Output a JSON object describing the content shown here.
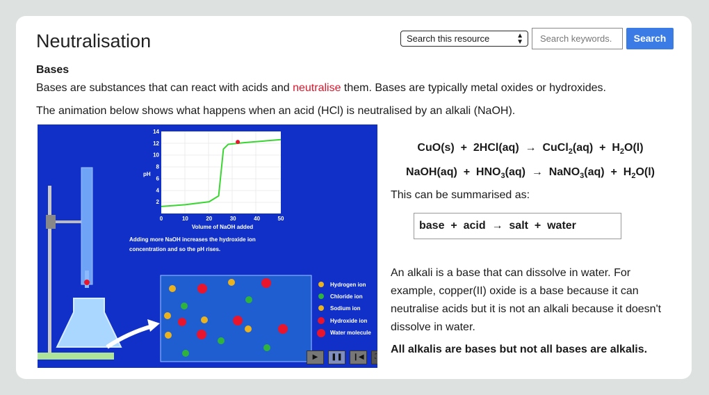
{
  "title": "Neutralisation",
  "search": {
    "scope": "Search this resource",
    "placeholder": "Search keywords.",
    "button": "Search"
  },
  "heading": "Bases",
  "intro": {
    "before": "Bases are substances that can react with acids and ",
    "link": "neutralise",
    "after": " them. Bases are typically metal oxides or hydroxides."
  },
  "animation_intro": "The animation below shows what happens when an acid (HCl) is neutralised by an alkali (NaOH).",
  "animation": {
    "y_label": "pH",
    "x_label": "Volume of NaOH added",
    "caption_1": "Adding more NaOH increases the hydroxide ion",
    "caption_2": "concentration and so the pH rises.",
    "y_ticks": [
      "14",
      "12",
      "10",
      "8",
      "6",
      "4",
      "2"
    ],
    "x_ticks": [
      "0",
      "10",
      "20",
      "30",
      "40",
      "50"
    ],
    "legend": [
      "Hydrogen ion",
      "Chloride ion",
      "Sodium ion",
      "Hydroxide ion",
      "Water molecule"
    ],
    "controls": [
      "play",
      "pause",
      "rewind",
      "fullscreen"
    ]
  },
  "equations": {
    "eq1": {
      "a": "CuO(s)",
      "b": "2HCl(aq)",
      "c_pre": "CuCl",
      "c_sub": "2",
      "c_post": "(aq)",
      "d_pre": "H",
      "d_sub": "2",
      "d_post": "O(l)"
    },
    "eq2": {
      "a": "NaOH(aq)",
      "b_pre": "HNO",
      "b_sub": "3",
      "b_post": "(aq)",
      "c_pre": "NaNO",
      "c_sub": "3",
      "c_post": "(aq)",
      "d_pre": "H",
      "d_sub": "2",
      "d_post": "O(l)"
    },
    "plus": "+",
    "arrow": "→"
  },
  "summary_intro": "This can be summarised as:",
  "summary_box": {
    "a": "base",
    "b": "acid",
    "c": "salt",
    "d": "water"
  },
  "alkali_text": "An alkali is a base that can dissolve in water. For example, copper(II) oxide is a base because it can neutralise acids but it is not an alkali because it doesn't dissolve in water.",
  "final_text": "All alkalis are bases but not all bases are alkalis."
}
